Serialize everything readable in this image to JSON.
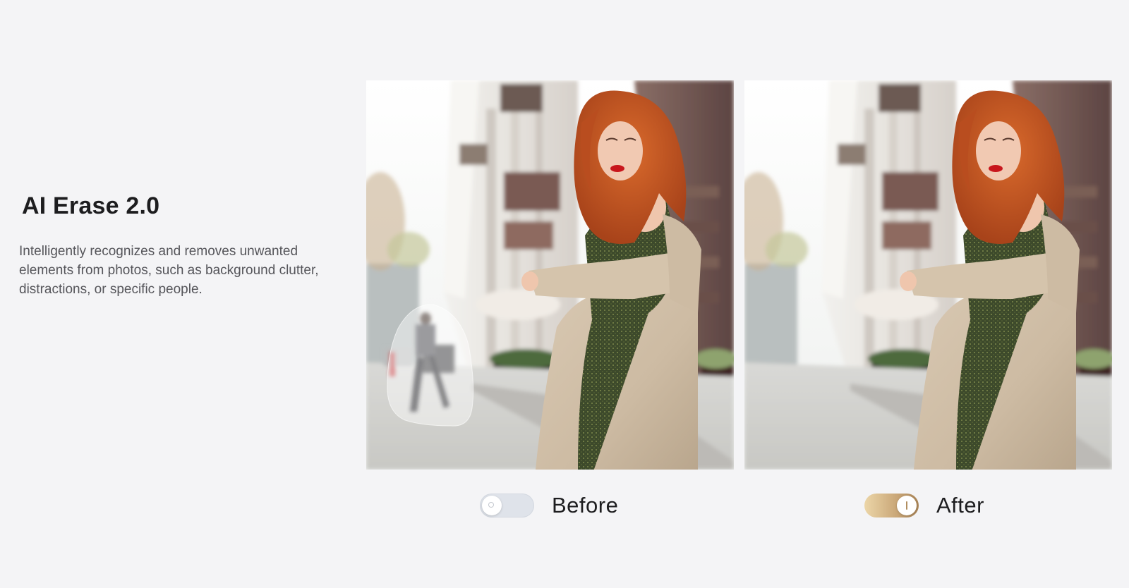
{
  "feature": {
    "title": "AI Erase 2.0",
    "description": "Intelligently recognizes and removes unwanted elements from photos, such as background clutter, distractions, or specific people."
  },
  "comparison": {
    "before": {
      "label": "Before",
      "toggle_state": "off"
    },
    "after": {
      "label": "After",
      "toggle_state": "on"
    }
  },
  "colors": {
    "page_background": "#f4f4f6",
    "title_text": "#1d1d1f",
    "body_text": "#55555a",
    "toggle_off": "#dfe3ea",
    "toggle_on_gold": "#c9a677"
  }
}
